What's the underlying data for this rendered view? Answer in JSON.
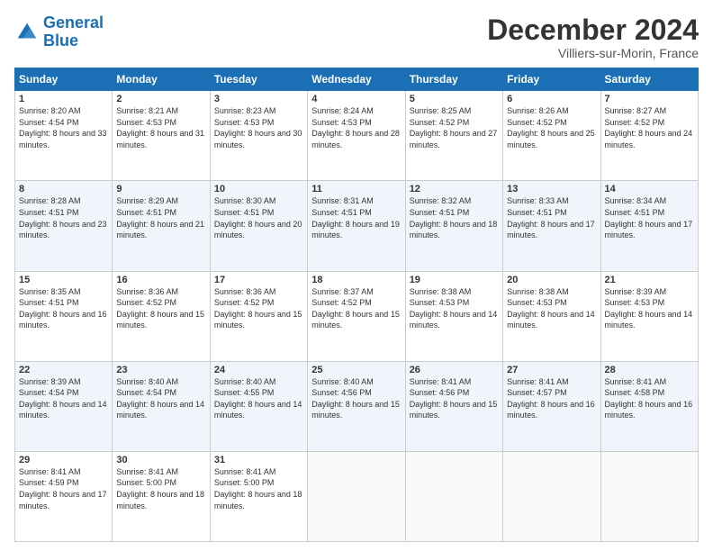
{
  "logo": {
    "text_general": "General",
    "text_blue": "Blue"
  },
  "header": {
    "month_title": "December 2024",
    "location": "Villiers-sur-Morin, France"
  },
  "weekdays": [
    "Sunday",
    "Monday",
    "Tuesday",
    "Wednesday",
    "Thursday",
    "Friday",
    "Saturday"
  ],
  "weeks": [
    [
      {
        "day": "1",
        "sunrise": "Sunrise: 8:20 AM",
        "sunset": "Sunset: 4:54 PM",
        "daylight": "Daylight: 8 hours and 33 minutes."
      },
      {
        "day": "2",
        "sunrise": "Sunrise: 8:21 AM",
        "sunset": "Sunset: 4:53 PM",
        "daylight": "Daylight: 8 hours and 31 minutes."
      },
      {
        "day": "3",
        "sunrise": "Sunrise: 8:23 AM",
        "sunset": "Sunset: 4:53 PM",
        "daylight": "Daylight: 8 hours and 30 minutes."
      },
      {
        "day": "4",
        "sunrise": "Sunrise: 8:24 AM",
        "sunset": "Sunset: 4:53 PM",
        "daylight": "Daylight: 8 hours and 28 minutes."
      },
      {
        "day": "5",
        "sunrise": "Sunrise: 8:25 AM",
        "sunset": "Sunset: 4:52 PM",
        "daylight": "Daylight: 8 hours and 27 minutes."
      },
      {
        "day": "6",
        "sunrise": "Sunrise: 8:26 AM",
        "sunset": "Sunset: 4:52 PM",
        "daylight": "Daylight: 8 hours and 25 minutes."
      },
      {
        "day": "7",
        "sunrise": "Sunrise: 8:27 AM",
        "sunset": "Sunset: 4:52 PM",
        "daylight": "Daylight: 8 hours and 24 minutes."
      }
    ],
    [
      {
        "day": "8",
        "sunrise": "Sunrise: 8:28 AM",
        "sunset": "Sunset: 4:51 PM",
        "daylight": "Daylight: 8 hours and 23 minutes."
      },
      {
        "day": "9",
        "sunrise": "Sunrise: 8:29 AM",
        "sunset": "Sunset: 4:51 PM",
        "daylight": "Daylight: 8 hours and 21 minutes."
      },
      {
        "day": "10",
        "sunrise": "Sunrise: 8:30 AM",
        "sunset": "Sunset: 4:51 PM",
        "daylight": "Daylight: 8 hours and 20 minutes."
      },
      {
        "day": "11",
        "sunrise": "Sunrise: 8:31 AM",
        "sunset": "Sunset: 4:51 PM",
        "daylight": "Daylight: 8 hours and 19 minutes."
      },
      {
        "day": "12",
        "sunrise": "Sunrise: 8:32 AM",
        "sunset": "Sunset: 4:51 PM",
        "daylight": "Daylight: 8 hours and 18 minutes."
      },
      {
        "day": "13",
        "sunrise": "Sunrise: 8:33 AM",
        "sunset": "Sunset: 4:51 PM",
        "daylight": "Daylight: 8 hours and 17 minutes."
      },
      {
        "day": "14",
        "sunrise": "Sunrise: 8:34 AM",
        "sunset": "Sunset: 4:51 PM",
        "daylight": "Daylight: 8 hours and 17 minutes."
      }
    ],
    [
      {
        "day": "15",
        "sunrise": "Sunrise: 8:35 AM",
        "sunset": "Sunset: 4:51 PM",
        "daylight": "Daylight: 8 hours and 16 minutes."
      },
      {
        "day": "16",
        "sunrise": "Sunrise: 8:36 AM",
        "sunset": "Sunset: 4:52 PM",
        "daylight": "Daylight: 8 hours and 15 minutes."
      },
      {
        "day": "17",
        "sunrise": "Sunrise: 8:36 AM",
        "sunset": "Sunset: 4:52 PM",
        "daylight": "Daylight: 8 hours and 15 minutes."
      },
      {
        "day": "18",
        "sunrise": "Sunrise: 8:37 AM",
        "sunset": "Sunset: 4:52 PM",
        "daylight": "Daylight: 8 hours and 15 minutes."
      },
      {
        "day": "19",
        "sunrise": "Sunrise: 8:38 AM",
        "sunset": "Sunset: 4:53 PM",
        "daylight": "Daylight: 8 hours and 14 minutes."
      },
      {
        "day": "20",
        "sunrise": "Sunrise: 8:38 AM",
        "sunset": "Sunset: 4:53 PM",
        "daylight": "Daylight: 8 hours and 14 minutes."
      },
      {
        "day": "21",
        "sunrise": "Sunrise: 8:39 AM",
        "sunset": "Sunset: 4:53 PM",
        "daylight": "Daylight: 8 hours and 14 minutes."
      }
    ],
    [
      {
        "day": "22",
        "sunrise": "Sunrise: 8:39 AM",
        "sunset": "Sunset: 4:54 PM",
        "daylight": "Daylight: 8 hours and 14 minutes."
      },
      {
        "day": "23",
        "sunrise": "Sunrise: 8:40 AM",
        "sunset": "Sunset: 4:54 PM",
        "daylight": "Daylight: 8 hours and 14 minutes."
      },
      {
        "day": "24",
        "sunrise": "Sunrise: 8:40 AM",
        "sunset": "Sunset: 4:55 PM",
        "daylight": "Daylight: 8 hours and 14 minutes."
      },
      {
        "day": "25",
        "sunrise": "Sunrise: 8:40 AM",
        "sunset": "Sunset: 4:56 PM",
        "daylight": "Daylight: 8 hours and 15 minutes."
      },
      {
        "day": "26",
        "sunrise": "Sunrise: 8:41 AM",
        "sunset": "Sunset: 4:56 PM",
        "daylight": "Daylight: 8 hours and 15 minutes."
      },
      {
        "day": "27",
        "sunrise": "Sunrise: 8:41 AM",
        "sunset": "Sunset: 4:57 PM",
        "daylight": "Daylight: 8 hours and 16 minutes."
      },
      {
        "day": "28",
        "sunrise": "Sunrise: 8:41 AM",
        "sunset": "Sunset: 4:58 PM",
        "daylight": "Daylight: 8 hours and 16 minutes."
      }
    ],
    [
      {
        "day": "29",
        "sunrise": "Sunrise: 8:41 AM",
        "sunset": "Sunset: 4:59 PM",
        "daylight": "Daylight: 8 hours and 17 minutes."
      },
      {
        "day": "30",
        "sunrise": "Sunrise: 8:41 AM",
        "sunset": "Sunset: 5:00 PM",
        "daylight": "Daylight: 8 hours and 18 minutes."
      },
      {
        "day": "31",
        "sunrise": "Sunrise: 8:41 AM",
        "sunset": "Sunset: 5:00 PM",
        "daylight": "Daylight: 8 hours and 18 minutes."
      },
      null,
      null,
      null,
      null
    ]
  ]
}
